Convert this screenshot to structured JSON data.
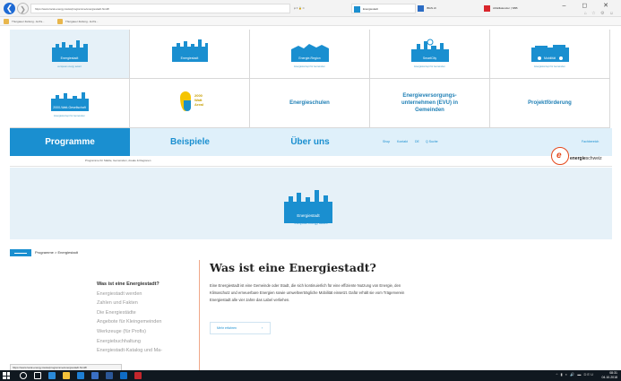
{
  "browser": {
    "url": "https://www.local-energy.swiss/programme/energiestadt.html#/",
    "url_tools": "⍴ ▾ 🔒 C",
    "tabs": [
      {
        "label": "Energiestadt",
        "active": true,
        "color": "#1a8fd0"
      },
      {
        "label": "IBAN.ch",
        "active": false,
        "color": "#2b6cc4"
      },
      {
        "label": "Abfallkalender | SBB",
        "active": false,
        "color": "#d9262c"
      }
    ],
    "window_controls": "– ◻ ✕",
    "chrome_icons": "⌂ ☆ ⚙ ☺",
    "favorites": [
      {
        "label": "Thurgauer Zeitung - E-Pa..."
      },
      {
        "label": "Thurgauer Zeitung - E-Pa..."
      }
    ],
    "status_url": "https://www.local-energy.swiss/programme/energiestadt.html#/"
  },
  "tiles": [
    {
      "kind": "logo",
      "label": "Energiestadt",
      "sub": "european energy award",
      "color": "#1a8fd0",
      "selected": true
    },
    {
      "kind": "logo",
      "label": "Energiestadt",
      "sub": "",
      "color": "#1a8fd0",
      "selected": false
    },
    {
      "kind": "logo",
      "label": "Energie-Region",
      "sub": "Energiekonzept für Gemeinden",
      "color": "#1a8fd0",
      "selected": false
    },
    {
      "kind": "logo",
      "label": "SmartCity",
      "sub": "Energiekonzept für Gemeinden",
      "color": "#1a8fd0",
      "selected": false
    },
    {
      "kind": "logo",
      "label": "Mobilität",
      "sub": "Energiekonzept für Gemeinden",
      "color": "#1a8fd0",
      "selected": false
    },
    {
      "kind": "logo",
      "label": "2000-Watt-Gesellschaft",
      "sub": "Energiekonzept für Gemeinden",
      "color": "#1a8fd0",
      "selected": false
    },
    {
      "kind": "watt",
      "label": "2000 Watt Areal",
      "sub": "",
      "color": "#f5c400",
      "selected": false
    },
    {
      "kind": "text",
      "label": "Energieschulen",
      "sub": "",
      "color": "#1e7fb5",
      "selected": false
    },
    {
      "kind": "text",
      "label": "Energieversorgungs-unternehmen (EVU) in Gemeinden",
      "sub": "",
      "color": "#1e7fb5",
      "selected": false
    },
    {
      "kind": "text",
      "label": "Projektförderung",
      "sub": "",
      "color": "#1e7fb5",
      "selected": false
    }
  ],
  "mainnav": {
    "items": [
      "Programme",
      "Beispiele",
      "Über uns"
    ],
    "utility": [
      "Shop",
      "Kontakt",
      "DE",
      "Q Suche"
    ],
    "pro_link": "Fachbereich"
  },
  "subbar_text": "Programme für Städte, Gemeinden, Areale & Regionen",
  "brand": {
    "mark": "e",
    "name_bold": "energie",
    "name": "schweiz"
  },
  "hero": {
    "label": "Energiestadt",
    "sub": "european energy award"
  },
  "breadcrumb": "Programme > Energiestadt",
  "sidenav": [
    "Was ist eine Energiestadt?",
    "Energiestadt werden",
    "Zahlen und Fakten",
    "Die Energiestädte",
    "Angebote für Kleingemeinden",
    "Werkzeuge (für Profis)",
    "Energiebuchhaltung",
    "Energiestadt-Katalog und Ma-"
  ],
  "article": {
    "title": "Was ist eine Energiestadt?",
    "body": "Eine Energiestadt ist eine Gemeinde oder Stadt, die sich kontinuierlich für eine effiziente Nutzung von Energie, den Klimaschutz und erneuerbare Energien sowie umweltverträgliche Mobilität einsetzt. Dafür erhält sie vom Trägerverein Energiestadt alle vier Jahre das Label verliehen.",
    "button": "Mehr erfahren",
    "button_arrow": "›"
  },
  "taskbar": {
    "tray": "^ ▮ ◐ 🔊 ▬ DEU",
    "time": "08:31",
    "date": "04.10.2018",
    "icons": [
      {
        "name": "search-icon",
        "color": "#ffffff"
      },
      {
        "name": "task-view-icon",
        "color": "#ffffff"
      },
      {
        "name": "edge-icon",
        "color": "#2b8ad8"
      },
      {
        "name": "explorer-icon",
        "color": "#f3c13a"
      },
      {
        "name": "ie-icon",
        "color": "#1e7fd4"
      },
      {
        "name": "mail-icon",
        "color": "#3a6fc4"
      },
      {
        "name": "word-icon",
        "color": "#2b5797"
      },
      {
        "name": "outlook-icon",
        "color": "#0f6cc4"
      },
      {
        "name": "app-icon",
        "color": "#c4262c"
      }
    ]
  }
}
